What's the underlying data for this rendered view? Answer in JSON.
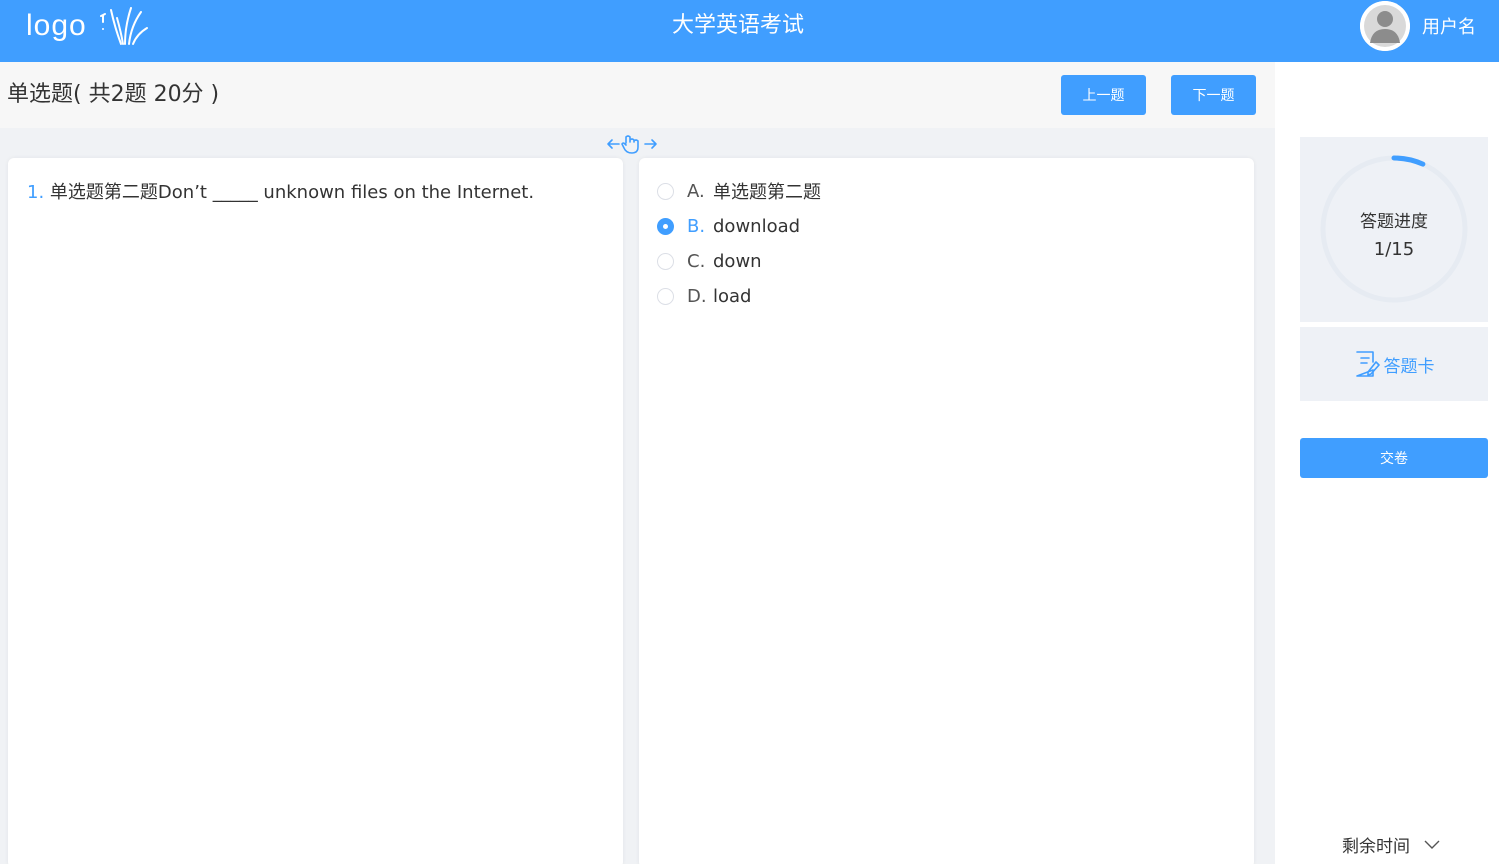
{
  "header": {
    "logo_text": "logo",
    "title": "大学英语考试",
    "username": "用户名"
  },
  "question_type": {
    "title": "单选题( 共2题 20分 )",
    "prev_label": "上一题",
    "next_label": "下一题"
  },
  "question": {
    "number": "1.",
    "text": "单选题第二题Don’t _____ unknown files on the Internet."
  },
  "options": [
    {
      "letter": "A.",
      "text": "单选题第二题",
      "selected": false
    },
    {
      "letter": "B.",
      "text": "download",
      "selected": true
    },
    {
      "letter": "C.",
      "text": "down",
      "selected": false
    },
    {
      "letter": "D.",
      "text": "load",
      "selected": false
    }
  ],
  "sidebar": {
    "progress_label": "答题进度",
    "progress_value": "1/15",
    "progress_fraction": 0.0667,
    "answer_card_label": "答题卡",
    "submit_label": "交卷",
    "remaining_label": "剩余时间"
  },
  "colors": {
    "primary": "#409eff",
    "track": "#e6ebf2"
  },
  "icons": [
    "logo-grass-icon",
    "avatar-icon",
    "drag-hand-icon",
    "answer-card-icon",
    "chevron-down-icon"
  ]
}
